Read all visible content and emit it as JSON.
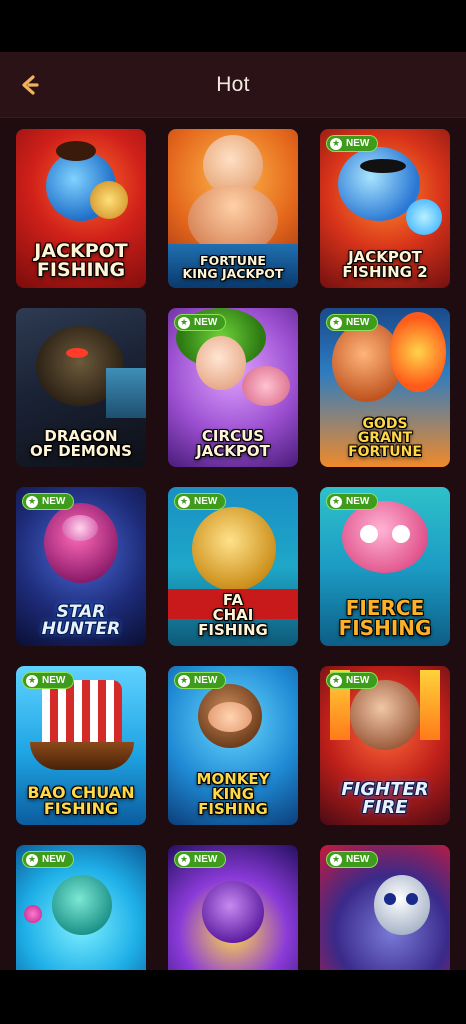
{
  "header": {
    "title": "Hot",
    "back_icon": "back-arrow-icon",
    "background": "#2a1216",
    "title_color": "#f4e9e0",
    "accent": "#f0b25a"
  },
  "badge_label": "NEW",
  "games": [
    {
      "title": "JACKPOT\nFISHING",
      "new": false
    },
    {
      "title": "FORTUNE\nKING JACKPOT",
      "new": false
    },
    {
      "title": "JACKPOT\nFISHING 2",
      "new": true
    },
    {
      "title": "DRAGON\nOF DEMONS",
      "new": false
    },
    {
      "title": "CIRCUS\nJACKPOT",
      "new": true
    },
    {
      "title": "GODS\nGRANT FORTUNE",
      "new": true
    },
    {
      "title": "STAR\nHUNTER",
      "new": true
    },
    {
      "title": "FA\nCHAI\nFISHING",
      "new": true
    },
    {
      "title": "FIERCE\nFISHING",
      "new": true
    },
    {
      "title": "BAO CHUAN\nFISHING",
      "new": true
    },
    {
      "title": "MONKEY\nKING\nFISHING",
      "new": true
    },
    {
      "title": "FIGHTER\nFIRE",
      "new": true
    },
    {
      "title": "",
      "new": true
    },
    {
      "title": "",
      "new": true
    },
    {
      "title": "",
      "new": true
    }
  ]
}
